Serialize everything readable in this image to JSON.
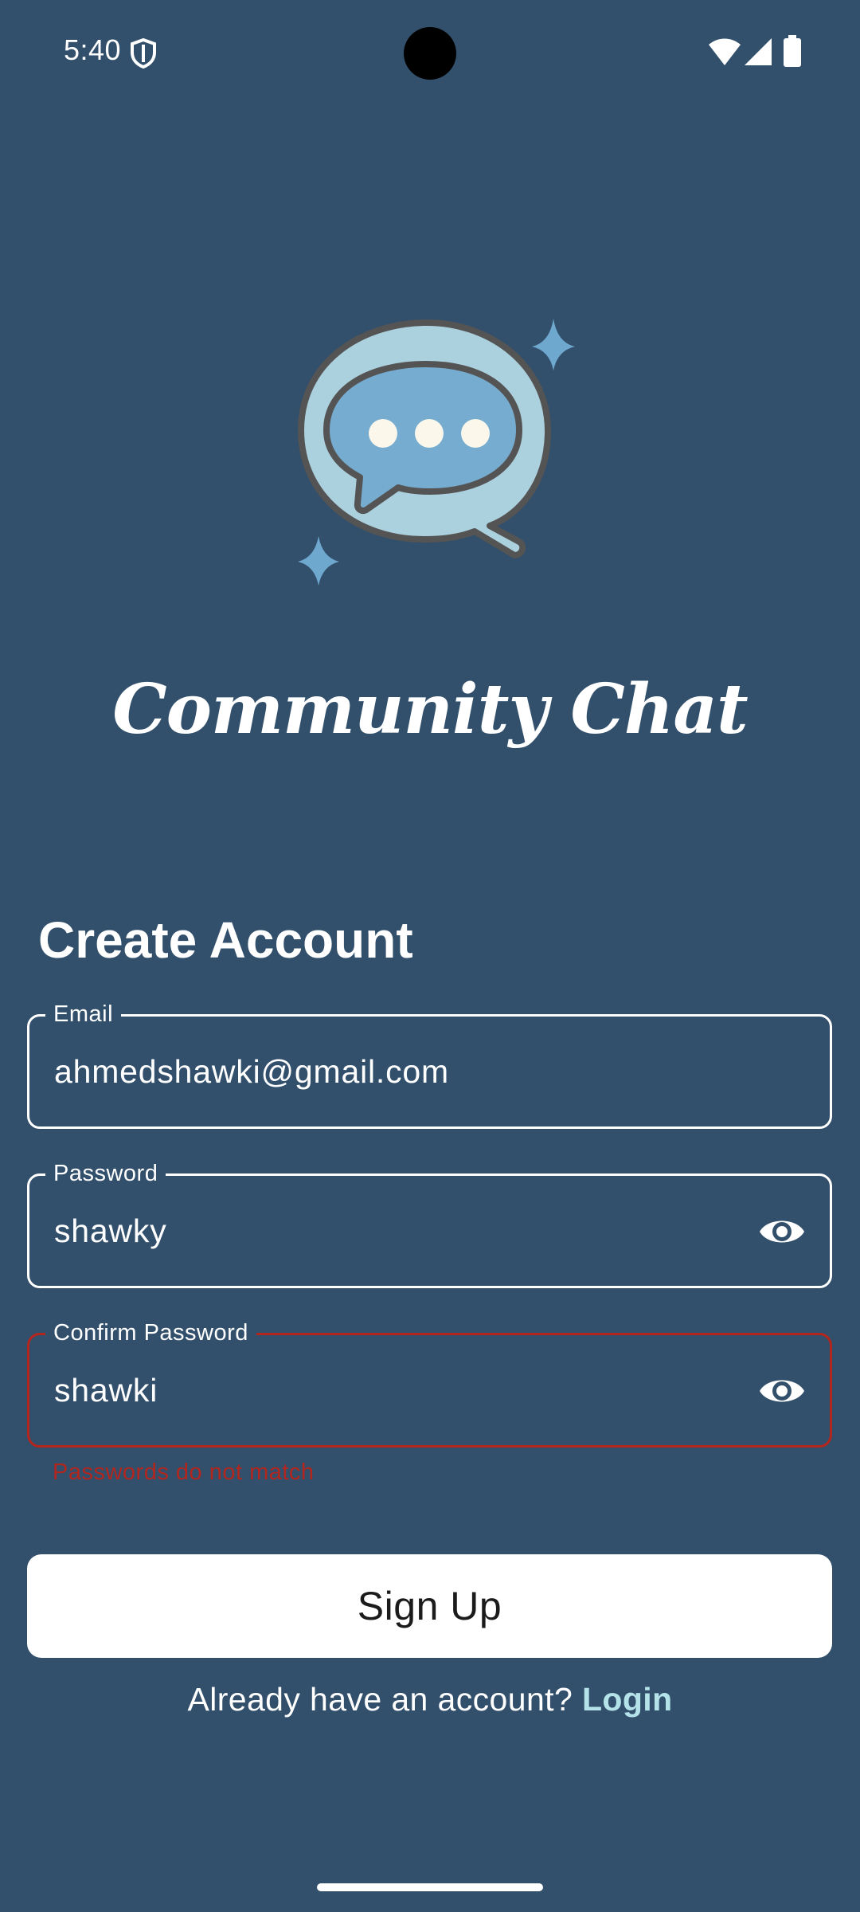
{
  "status_bar": {
    "time": "5:40",
    "icons": [
      "shield-icon",
      "wifi-icon",
      "signal-icon",
      "battery-icon"
    ]
  },
  "app": {
    "title": "Community Chat",
    "logo_icon": "chat-bubble-logo-icon"
  },
  "form": {
    "heading": "Create Account",
    "email": {
      "label": "Email",
      "value": "ahmedshawki@gmail.com"
    },
    "password": {
      "label": "Password",
      "value": "shawky",
      "toggle_icon": "eye-icon"
    },
    "confirm_password": {
      "label": "Confirm Password",
      "value": "shawki",
      "toggle_icon": "eye-icon",
      "error": "Passwords do not match"
    },
    "submit_label": "Sign Up",
    "login_prompt": "Already have an account?",
    "login_link": "Login"
  },
  "colors": {
    "background": "#32506c",
    "error": "#b3261e",
    "link": "#b5e3ea",
    "button_bg": "#ffffff"
  }
}
